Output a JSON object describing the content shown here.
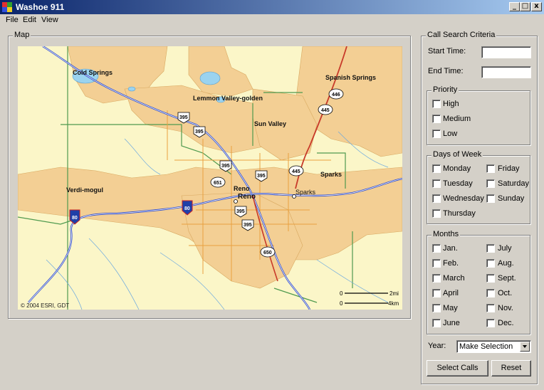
{
  "window": {
    "title": "Washoe 911",
    "minimize_label": "_",
    "maximize_label": "□",
    "close_label": "x"
  },
  "menu": {
    "items": [
      "File",
      "Edit",
      "View"
    ]
  },
  "map_group": {
    "label": "Map",
    "places": [
      "Cold Springs",
      "Lemmon Valley-golden",
      "Spanish Springs",
      "Sun Valley",
      "Sparks",
      "Verdi-mogul",
      "Reno",
      "Reno",
      "Sparks"
    ],
    "shields": [
      "446",
      "445",
      "395",
      "395",
      "395",
      "395",
      "445",
      "651",
      "395",
      "395",
      "650"
    ],
    "interstates": [
      "80",
      "80"
    ],
    "copyright": "© 2004 ESRI, GDT",
    "scale": {
      "start": "0",
      "end1": "2mi",
      "end2": "4km"
    }
  },
  "search_criteria": {
    "label": "Call Search Criteria",
    "start_time_label": "Start Time:",
    "start_time_value": "",
    "end_time_label": "End Time:",
    "end_time_value": "",
    "priority": {
      "label": "Priority",
      "options": [
        "High",
        "Medium",
        "Low"
      ]
    },
    "days": {
      "label": "Days of Week",
      "options": [
        "Monday",
        "Tuesday",
        "Wednesday",
        "Thursday",
        "Friday",
        "Saturday",
        "Sunday"
      ]
    },
    "months": {
      "label": "Months",
      "options": [
        "Jan.",
        "Feb.",
        "March",
        "April",
        "May",
        "June",
        "July",
        "Aug.",
        "Sept.",
        "Oct.",
        "Nov.",
        "Dec."
      ]
    },
    "year_label": "Year:",
    "year_selected": "Make Selection",
    "select_button": "Select Calls",
    "reset_button": "Reset"
  },
  "colors": {
    "titlebar_start": "#0a246a",
    "titlebar_end": "#a6caf0",
    "map_background": "#fbf6c8",
    "urban_area": "#f3cf94",
    "water": "#9bd3ef",
    "highway": "#2a48c8",
    "main_road": "#c83a2a"
  }
}
